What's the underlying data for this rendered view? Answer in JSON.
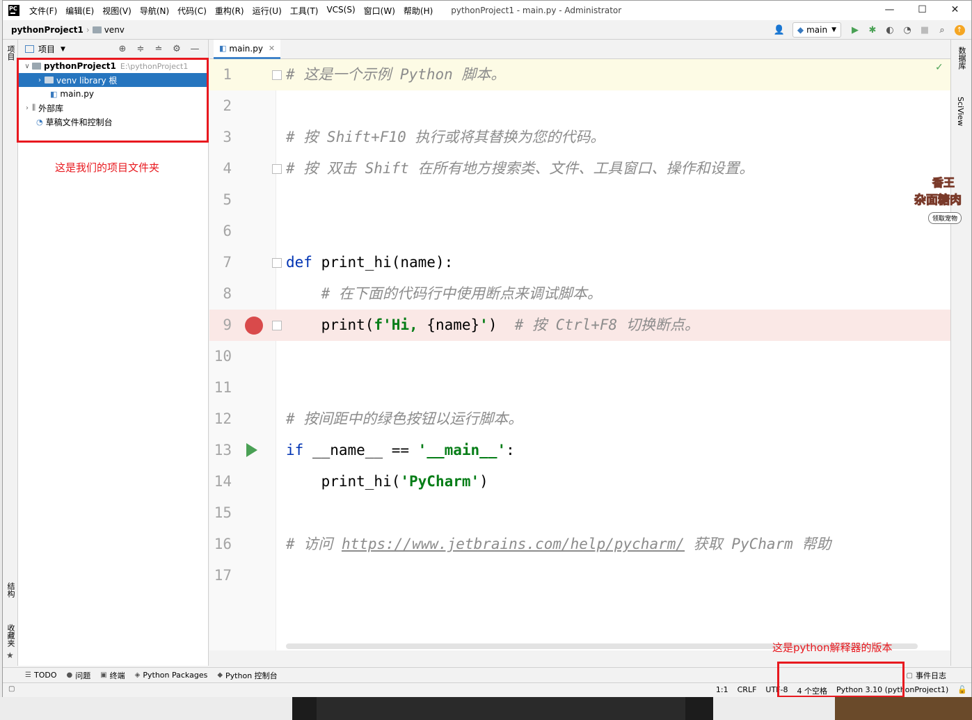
{
  "app": {
    "logo_text": "PC",
    "menu": [
      "文件(F)",
      "编辑(E)",
      "视图(V)",
      "导航(N)",
      "代码(C)",
      "重构(R)",
      "运行(U)",
      "工具(T)",
      "VCS(S)",
      "窗口(W)",
      "帮助(H)"
    ],
    "window_title": "pythonProject1 - main.py - Administrator",
    "controls": [
      "—",
      "☐",
      "✕"
    ]
  },
  "navbar": {
    "project": "pythonProject1",
    "folder": "venv",
    "branch": "main"
  },
  "left_strip": {
    "project_tab": "项目",
    "structure_tab": "结构",
    "favorites_tab": "收藏夹"
  },
  "project_panel": {
    "title": "项目",
    "tree": [
      {
        "label": "pythonProject1",
        "hint": "E:\\pythonProject1"
      },
      {
        "label": "venv  library 根"
      },
      {
        "label": "main.py"
      },
      {
        "label": "外部库"
      },
      {
        "label": "草稿文件和控制台"
      }
    ],
    "annotation": "这是我们的项目文件夹"
  },
  "editor": {
    "tab": "main.py",
    "lines": [
      {
        "num": "1"
      },
      {
        "num": "2"
      },
      {
        "num": "3"
      },
      {
        "num": "4"
      },
      {
        "num": "5"
      },
      {
        "num": "6"
      },
      {
        "num": "7"
      },
      {
        "num": "8"
      },
      {
        "num": "9"
      },
      {
        "num": "10"
      },
      {
        "num": "11"
      },
      {
        "num": "12"
      },
      {
        "num": "13"
      },
      {
        "num": "14"
      },
      {
        "num": "15"
      },
      {
        "num": "16"
      },
      {
        "num": "17"
      }
    ],
    "code": {
      "l1": "# 这是一个示例 Python 脚本。",
      "l3": "# 按 Shift+F10 执行或将其替换为您的代码。",
      "l4": "# 按 双击 Shift 在所有地方搜索类、文件、工具窗口、操作和设置。",
      "l7_kw": "def",
      "l7_rest": " print_hi(name):",
      "l8": "    # 在下面的代码行中使用断点来调试脚本。",
      "l9_fn": "    print(",
      "l9_str": "f'Hi, ",
      "l9_expr": "{name}",
      "l9_str2": "'",
      "l9_close": ")  ",
      "l9_cm": "# 按 Ctrl+F8 切换断点。",
      "l12": "# 按间距中的绿色按钮以运行脚本。",
      "l13_kw": "if",
      "l13_mid": " __name__ == ",
      "l13_str": "'__main__'",
      "l13_end": ":",
      "l14_fn": "    print_hi(",
      "l14_str": "'PyCharm'",
      "l14_end": ")",
      "l16_cm": "# 访问 ",
      "l16_url": "https://www.jetbrains.com/help/pycharm/",
      "l16_cm2": " 获取 PyCharm 帮助"
    }
  },
  "right_strip": {
    "database_tab": "数据库",
    "sciview_tab": "SciView"
  },
  "pet": {
    "line1": "香王",
    "line2": "杂面糖肉",
    "button": "领取宠物"
  },
  "tool_windows": [
    "TODO",
    "问题",
    "终端",
    "Python Packages",
    "Python 控制台"
  ],
  "event_log": "事件日志",
  "status": {
    "position": "1:1",
    "line_sep": "CRLF",
    "encoding": "UTF-8",
    "indent": "4 个空格",
    "interpreter": "Python 3.10 (pythonProject1)"
  },
  "interpreter_annotation": "这是python解释器的版本"
}
